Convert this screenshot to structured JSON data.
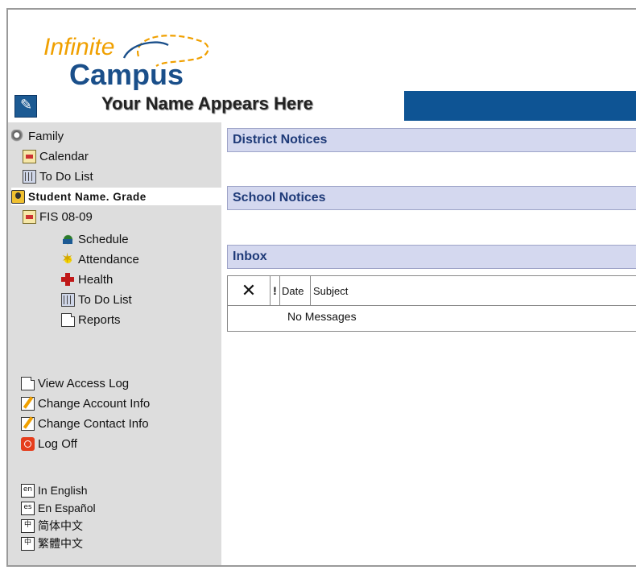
{
  "logo": {
    "line1": "Infinite",
    "line2": "Campus"
  },
  "banner": {
    "user_name": "Your Name Appears Here"
  },
  "sidebar": {
    "family": "Family",
    "family_calendar": "Calendar",
    "family_todo": "To Do List",
    "student": "Student Name. Grade",
    "calendar_year": "FIS 08-09",
    "schedule": "Schedule",
    "attendance": "Attendance",
    "health": "Health",
    "student_todo": "To Do List",
    "reports": "Reports",
    "view_access_log": "View Access Log",
    "change_account_info": "Change Account Info",
    "change_contact_info": "Change Contact Info",
    "log_off": "Log Off",
    "languages": [
      {
        "code": "en",
        "label": "In English"
      },
      {
        "code": "es",
        "label": "En Español"
      },
      {
        "code": "中",
        "label": "简体中文"
      },
      {
        "code": "中",
        "label": "繁體中文"
      }
    ]
  },
  "main": {
    "district_notices": "District Notices",
    "school_notices": "School Notices",
    "inbox": {
      "title": "Inbox",
      "columns": {
        "delete": "✕",
        "priority": "!",
        "date": "Date",
        "subject": "Subject"
      },
      "empty_message": "No Messages"
    }
  },
  "colors": {
    "banner_blue": "#0e5494",
    "section_header_bg": "#d4d8ef",
    "section_header_text": "#1e3a78",
    "sidebar_bg": "#dddddd",
    "logo_orange": "#f0a000",
    "logo_blue": "#1a4f8a"
  }
}
